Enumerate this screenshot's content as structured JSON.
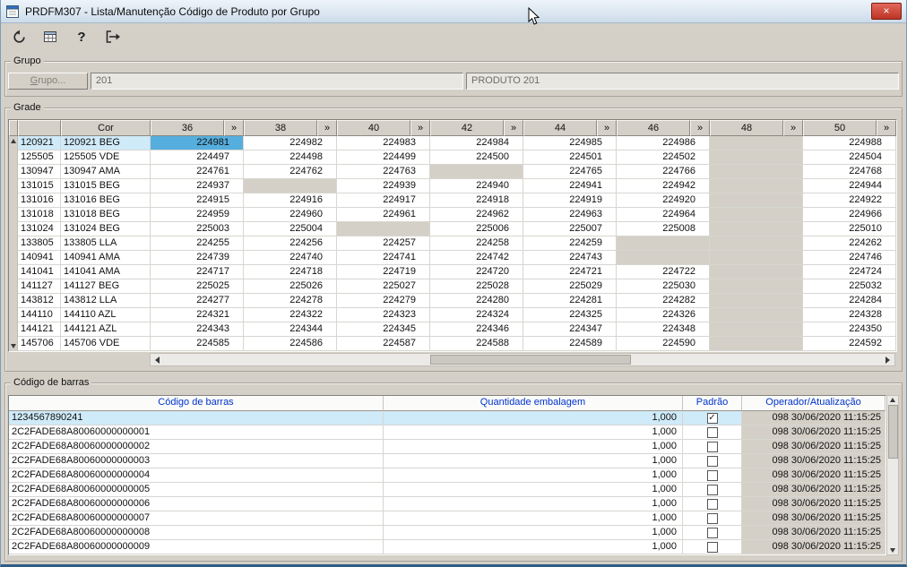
{
  "window": {
    "title": "PRDFM307 - Lista/Manutenção Código de Produto por Grupo"
  },
  "titlebar": {
    "close_glyph": "×"
  },
  "toolbar": {
    "help_glyph": "?",
    "icons": [
      "undo-icon",
      "grid-icon",
      "help-icon",
      "exit-icon"
    ]
  },
  "grupo": {
    "legend": "Grupo",
    "button": "Grupo...",
    "code": "201",
    "descricao": "PRODUTO 201"
  },
  "grade": {
    "legend": "Grade",
    "cor_header": "Cor",
    "expand_glyph": "»",
    "sizes": [
      "36",
      "38",
      "40",
      "42",
      "44",
      "46",
      "48",
      "50"
    ],
    "selected": {
      "row": 0,
      "col": 0
    },
    "rows": [
      {
        "code": "120921",
        "cor": "120921 BEG",
        "values": [
          "224981",
          "224982",
          "224983",
          "224984",
          "224985",
          "224986",
          "",
          "224988"
        ]
      },
      {
        "code": "125505",
        "cor": "125505 VDE",
        "values": [
          "224497",
          "224498",
          "224499",
          "224500",
          "224501",
          "224502",
          "",
          "224504"
        ]
      },
      {
        "code": "130947",
        "cor": "130947 AMA",
        "values": [
          "224761",
          "224762",
          "224763",
          "",
          "224765",
          "224766",
          "",
          "224768"
        ]
      },
      {
        "code": "131015",
        "cor": "131015 BEG",
        "values": [
          "224937",
          "",
          "224939",
          "224940",
          "224941",
          "224942",
          "",
          "224944"
        ]
      },
      {
        "code": "131016",
        "cor": "131016 BEG",
        "values": [
          "224915",
          "224916",
          "224917",
          "224918",
          "224919",
          "224920",
          "",
          "224922"
        ]
      },
      {
        "code": "131018",
        "cor": "131018 BEG",
        "values": [
          "224959",
          "224960",
          "224961",
          "224962",
          "224963",
          "224964",
          "",
          "224966"
        ]
      },
      {
        "code": "131024",
        "cor": "131024 BEG",
        "values": [
          "225003",
          "225004",
          "",
          "225006",
          "225007",
          "225008",
          "",
          "225010"
        ]
      },
      {
        "code": "133805",
        "cor": "133805 LLA",
        "values": [
          "224255",
          "224256",
          "224257",
          "224258",
          "224259",
          "",
          "",
          "224262"
        ]
      },
      {
        "code": "140941",
        "cor": "140941 AMA",
        "values": [
          "224739",
          "224740",
          "224741",
          "224742",
          "224743",
          "",
          "",
          "224746"
        ]
      },
      {
        "code": "141041",
        "cor": "141041 AMA",
        "values": [
          "224717",
          "224718",
          "224719",
          "224720",
          "224721",
          "224722",
          "",
          "224724"
        ]
      },
      {
        "code": "141127",
        "cor": "141127 BEG",
        "values": [
          "225025",
          "225026",
          "225027",
          "225028",
          "225029",
          "225030",
          "",
          "225032"
        ]
      },
      {
        "code": "143812",
        "cor": "143812 LLA",
        "values": [
          "224277",
          "224278",
          "224279",
          "224280",
          "224281",
          "224282",
          "",
          "224284"
        ]
      },
      {
        "code": "144110",
        "cor": "144110 AZL",
        "values": [
          "224321",
          "224322",
          "224323",
          "224324",
          "224325",
          "224326",
          "",
          "224328"
        ]
      },
      {
        "code": "144121",
        "cor": "144121 AZL",
        "values": [
          "224343",
          "224344",
          "224345",
          "224346",
          "224347",
          "224348",
          "",
          "224350"
        ]
      },
      {
        "code": "145706",
        "cor": "145706 VDE",
        "values": [
          "224585",
          "224586",
          "224587",
          "224588",
          "224589",
          "224590",
          "",
          "224592"
        ]
      }
    ]
  },
  "barras": {
    "legend": "Código de barras",
    "headers": [
      "Código de barras",
      "Quantidade embalagem",
      "Padrão",
      "Operador/Atualização"
    ],
    "rows": [
      {
        "codigo": "1234567890241",
        "quantidade": "1,000",
        "padrao": true,
        "operador": "098 30/06/2020 11:15:25",
        "selected": true
      },
      {
        "codigo": "2C2FADE68A80060000000001",
        "quantidade": "1,000",
        "padrao": false,
        "operador": "098 30/06/2020 11:15:25"
      },
      {
        "codigo": "2C2FADE68A80060000000002",
        "quantidade": "1,000",
        "padrao": false,
        "operador": "098 30/06/2020 11:15:25"
      },
      {
        "codigo": "2C2FADE68A80060000000003",
        "quantidade": "1,000",
        "padrao": false,
        "operador": "098 30/06/2020 11:15:25"
      },
      {
        "codigo": "2C2FADE68A80060000000004",
        "quantidade": "1,000",
        "padrao": false,
        "operador": "098 30/06/2020 11:15:25"
      },
      {
        "codigo": "2C2FADE68A80060000000005",
        "quantidade": "1,000",
        "padrao": false,
        "operador": "098 30/06/2020 11:15:25"
      },
      {
        "codigo": "2C2FADE68A80060000000006",
        "quantidade": "1,000",
        "padrao": false,
        "operador": "098 30/06/2020 11:15:25"
      },
      {
        "codigo": "2C2FADE68A80060000000007",
        "quantidade": "1,000",
        "padrao": false,
        "operador": "098 30/06/2020 11:15:25"
      },
      {
        "codigo": "2C2FADE68A80060000000008",
        "quantidade": "1,000",
        "padrao": false,
        "operador": "098 30/06/2020 11:15:25"
      },
      {
        "codigo": "2C2FADE68A80060000000009",
        "quantidade": "1,000",
        "padrao": false,
        "operador": "098 30/06/2020 11:15:25"
      }
    ]
  },
  "colors": {
    "window_chrome": "#d4d0c8",
    "selected_cell_blue": "#56aede",
    "selected_row_blue": "#cfeaf8",
    "disabled_cell_gray": "#d4d0c8",
    "table_header_text_blue": "#0033cc",
    "close_button_red": "#bd3425"
  }
}
